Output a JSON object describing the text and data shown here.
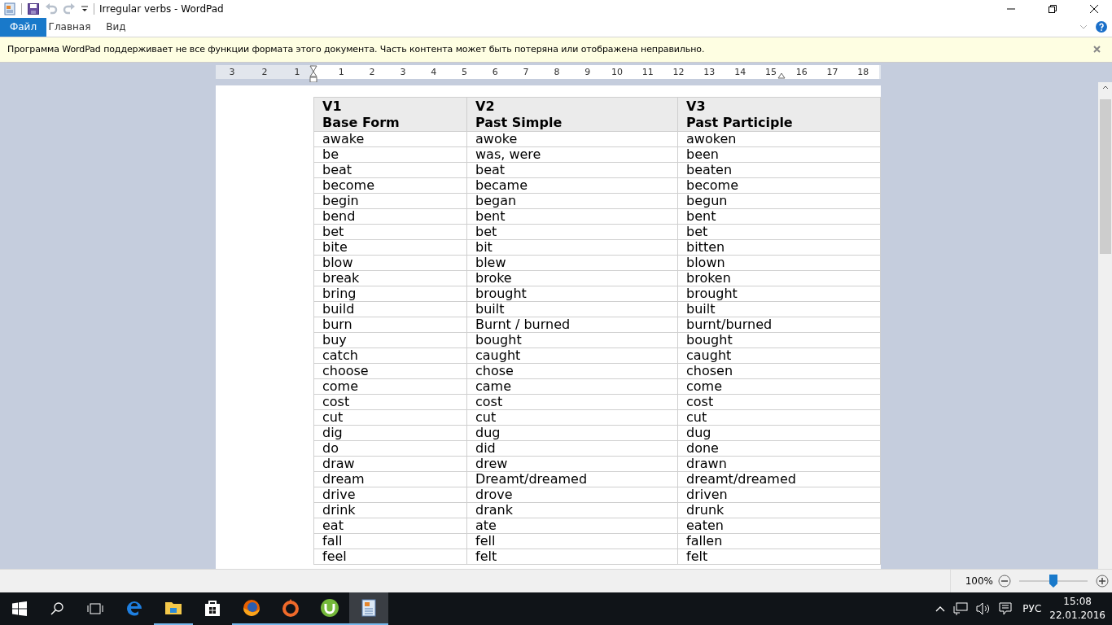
{
  "window": {
    "title": "Irregular verbs - WordPad"
  },
  "tabs": [
    {
      "label": "Файл",
      "selected": true
    },
    {
      "label": "Главная",
      "selected": false
    },
    {
      "label": "Вид",
      "selected": false
    }
  ],
  "info_bar": {
    "message": "Программа WordPad поддерживает не все функции формата этого документа. Часть контента может быть потеряна или отображена неправильно."
  },
  "ruler": {
    "left_labels": [
      "3",
      "2",
      "1"
    ],
    "right_labels": [
      "1",
      "2",
      "3",
      "4",
      "5",
      "6",
      "7",
      "8",
      "9",
      "10",
      "11",
      "12",
      "13",
      "14",
      "15",
      "16",
      "17",
      "18"
    ]
  },
  "table": {
    "columns": [
      {
        "code": "V1",
        "name": "Base Form"
      },
      {
        "code": "V2",
        "name": "Past Simple"
      },
      {
        "code": "V3",
        "name": "Past Participle"
      }
    ],
    "rows": [
      [
        "awake",
        "awoke",
        "awoken"
      ],
      [
        "be",
        "was, were",
        "been"
      ],
      [
        "beat",
        "beat",
        "beaten"
      ],
      [
        "become",
        "became",
        "become"
      ],
      [
        "begin",
        "began",
        "begun"
      ],
      [
        "bend",
        "bent",
        "bent"
      ],
      [
        "bet",
        "bet",
        "bet"
      ],
      [
        "bite",
        "bit",
        "bitten"
      ],
      [
        "blow",
        "blew",
        "blown"
      ],
      [
        "break",
        "broke",
        "broken"
      ],
      [
        "bring",
        "brought",
        "brought"
      ],
      [
        "build",
        "built",
        "built"
      ],
      [
        "burn",
        "Burnt / burned",
        "burnt/burned"
      ],
      [
        "buy",
        "bought",
        "bought"
      ],
      [
        "catch",
        "caught",
        "caught"
      ],
      [
        "choose",
        "chose",
        "chosen"
      ],
      [
        "come",
        "came",
        "come"
      ],
      [
        "cost",
        "cost",
        "cost"
      ],
      [
        "cut",
        "cut",
        "cut"
      ],
      [
        "dig",
        "dug",
        "dug"
      ],
      [
        "do",
        "did",
        "done"
      ],
      [
        "draw",
        "drew",
        "drawn"
      ],
      [
        "dream",
        "Dreamt/dreamed",
        "dreamt/dreamed"
      ],
      [
        "drive",
        "drove",
        "driven"
      ],
      [
        "drink",
        "drank",
        "drunk"
      ],
      [
        "eat",
        "ate",
        "eaten"
      ],
      [
        "fall",
        "fell",
        "fallen"
      ],
      [
        "feel",
        "felt",
        "felt"
      ]
    ]
  },
  "zoom": {
    "reading": "100%",
    "level": 0.5
  },
  "taskbar": {
    "apps": [
      {
        "kind": "edge",
        "running": false,
        "selected": false
      },
      {
        "kind": "folder",
        "running": true,
        "selected": false
      },
      {
        "kind": "store",
        "running": false,
        "selected": false
      },
      {
        "kind": "firefox",
        "running": true,
        "selected": false
      },
      {
        "kind": "origin",
        "running": true,
        "selected": false
      },
      {
        "kind": "torrent",
        "running": true,
        "selected": false
      },
      {
        "kind": "wordpad",
        "running": true,
        "selected": true
      }
    ],
    "language": "РУС",
    "time": "15:08",
    "date": "22.01.2016"
  }
}
